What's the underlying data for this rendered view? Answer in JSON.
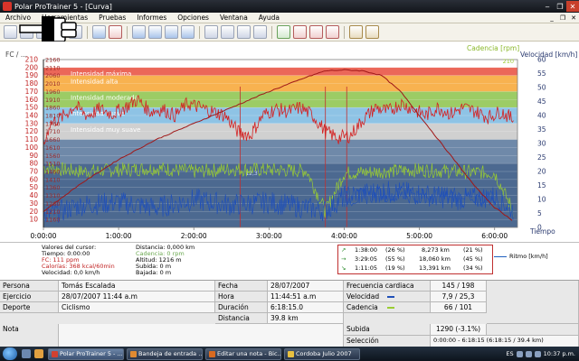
{
  "window": {
    "title": "Polar ProTrainer 5 - [Curva]"
  },
  "menu": {
    "items": [
      "Archivo",
      "Herramientas",
      "Pruebas",
      "Informes",
      "Opciones",
      "Ventana",
      "Ayuda"
    ],
    "mdi_buttons": [
      "_",
      "❐",
      "✕"
    ]
  },
  "chart": {
    "left_axis_title": "FC / ...",
    "cadence_title": "Cadencia [rpm]",
    "speed_title": "Velocidad [km/h]",
    "x_axis_title": "Tiempo",
    "marker_label": "12,3",
    "hr_ticks": [
      "210",
      "200",
      "190",
      "180",
      "170",
      "160",
      "150",
      "140",
      "130",
      "120",
      "110",
      "100",
      "90",
      "80",
      "70",
      "60",
      "50",
      "40",
      "30",
      "20",
      "10"
    ],
    "alt_ticks": [
      "2160",
      "2110",
      "2060",
      "2010",
      "1960",
      "1910",
      "1860",
      "1810",
      "1760",
      "1710",
      "1660",
      "1610",
      "1560",
      "1510",
      "1460",
      "1410",
      "1360",
      "1310",
      "1260",
      "1210",
      "1160"
    ],
    "speed_ticks": [
      "60",
      "55",
      "50",
      "45",
      "40",
      "35",
      "30",
      "25",
      "20",
      "15",
      "10",
      "5",
      "0"
    ],
    "cadence_top": "210",
    "time_ticks": [
      "0:00:00",
      "1:00:00",
      "2:00:00",
      "3:00:00",
      "4:00:00",
      "5:00:00",
      "6:00:00"
    ],
    "zones": [
      {
        "label": "Intensidad máxima",
        "color": "#e84c3c"
      },
      {
        "label": "Intensidad alta",
        "color": "#f7a531"
      },
      {
        "label": "Intensidad moderada",
        "color": "#8bc34a"
      },
      {
        "label": "Intensidad suave",
        "color": "#7ab8e0"
      },
      {
        "label": "Intensidad muy suave",
        "color": "#c8c8c8"
      }
    ],
    "colors": {
      "hr": "#d42020",
      "altitude": "#a01818",
      "speed": "#2050b8",
      "cadence": "#9acd32"
    }
  },
  "chart_data": {
    "type": "line",
    "x_unit": "time (h:mm:ss)",
    "xlim": [
      "0:00:00",
      "6:18:15"
    ],
    "ylim_hr": [
      0,
      210
    ],
    "ylim_speed": [
      0,
      60
    ],
    "series": [
      {
        "name": "FC",
        "axis": "hr",
        "x": [
          "0:00:00",
          "0:05:00",
          "0:15:00",
          "0:25:00",
          "0:35:00",
          "0:45:00",
          "0:55:00",
          "1:05:00",
          "1:15:00",
          "1:25:00",
          "1:35:00",
          "1:45:00",
          "1:55:00",
          "2:05:00",
          "2:15:00",
          "2:25:00",
          "2:35:00",
          "2:45:00",
          "2:55:00",
          "3:05:00",
          "3:15:00",
          "3:25:00",
          "3:35:00",
          "3:45:00",
          "3:55:00",
          "4:05:00",
          "4:15:00",
          "4:25:00",
          "4:35:00",
          "4:45:00",
          "4:55:00",
          "5:05:00",
          "5:15:00",
          "5:25:00",
          "5:35:00",
          "5:45:00",
          "5:55:00",
          "6:05:00",
          "6:15:00"
        ],
        "values": [
          100,
          130,
          138,
          152,
          140,
          148,
          142,
          150,
          160,
          145,
          148,
          140,
          155,
          150,
          145,
          140,
          120,
          115,
          140,
          148,
          145,
          150,
          140,
          120,
          112,
          115,
          135,
          150,
          145,
          155,
          148,
          140,
          150,
          142,
          150,
          145,
          138,
          145,
          135
        ]
      },
      {
        "name": "Altitud",
        "axis": "hr",
        "x": [
          "0:00:00",
          "0:30:00",
          "1:00:00",
          "1:30:00",
          "2:00:00",
          "2:30:00",
          "3:00:00",
          "3:30:00",
          "3:45:00",
          "4:00:00",
          "4:15:00",
          "4:30:00",
          "4:45:00",
          "5:00:00",
          "5:15:00",
          "5:30:00",
          "5:45:00",
          "6:00:00",
          "6:15:00"
        ],
        "values": [
          20,
          55,
          85,
          110,
          130,
          150,
          170,
          188,
          196,
          197,
          196,
          190,
          170,
          140,
          110,
          80,
          50,
          25,
          8
        ]
      },
      {
        "name": "Velocidad",
        "axis": "speed",
        "x": [
          "0:00:00",
          "0:30:00",
          "1:00:00",
          "1:30:00",
          "2:00:00",
          "2:30:00",
          "3:00:00",
          "3:30:00",
          "3:45:00",
          "4:00:00",
          "4:30:00",
          "5:00:00",
          "5:30:00",
          "6:00:00",
          "6:15:00"
        ],
        "values": [
          4,
          8,
          9,
          7,
          10,
          8,
          9,
          7,
          6,
          11,
          13,
          12,
          10,
          11,
          6
        ]
      },
      {
        "name": "Cadencia",
        "axis": "hr",
        "x": [
          "0:00:00",
          "0:30:00",
          "1:00:00",
          "1:30:00",
          "2:00:00",
          "2:30:00",
          "3:00:00",
          "3:30:00",
          "3:45:00",
          "4:00:00",
          "4:30:00",
          "5:00:00",
          "5:30:00",
          "6:00:00",
          "6:15:00"
        ],
        "values": [
          75,
          70,
          72,
          74,
          70,
          73,
          72,
          71,
          20,
          68,
          70,
          72,
          70,
          68,
          20
        ]
      },
      {
        "name": "Ritmo [km/h]",
        "axis": "speed",
        "x": [
          "4:00:00",
          "4:30:00",
          "5:00:00",
          "5:30:00",
          "6:00:00"
        ],
        "values": [
          10,
          12,
          11,
          12,
          10
        ]
      }
    ]
  },
  "cursor": {
    "title": "Valores del cursor:",
    "time": "Tiempo: 0:00:00",
    "hr": "FC: 111 ppm",
    "calories": "Calorías: 368 kcal/60min",
    "speed": "Velocidad: 0,0 km/h",
    "distance": "Distancia: 0,000 km",
    "cadence": "Cadencia: 0 rpm",
    "altitude": "Altitud: 1216 m",
    "ascent": "Subida: 0 m",
    "descent": "Bajada: 0 m"
  },
  "zones_summary": [
    {
      "arrow": "↗",
      "time": "1:38:00",
      "pct": "(26 %)",
      "km": "8,273 km",
      "kmpct": "(21 %)"
    },
    {
      "arrow": "→",
      "time": "3:29:05",
      "pct": "(55 %)",
      "km": "18,060 km",
      "kmpct": "(45 %)"
    },
    {
      "arrow": "↘",
      "time": "1:11:05",
      "pct": "(19 %)",
      "km": "13,391 km",
      "kmpct": "(34 %)"
    }
  ],
  "legend": {
    "ritmo": "Ritmo [km/h]"
  },
  "info": {
    "persona_label": "Persona",
    "persona_value": "Tomás Escalada",
    "ejercicio_label": "Ejercicio",
    "ejercicio_value": "28/07/2007 11:44 a.m",
    "deporte_label": "Deporte",
    "deporte_value": "Ciclismo",
    "fecha_label": "Fecha",
    "fecha_value": "28/07/2007",
    "hora_label": "Hora",
    "hora_value": "11:44:51 a.m",
    "duracion_label": "Duración",
    "duracion_value": "6:18:15.0",
    "distancia_label": "Distancia",
    "distancia_value": "39.8 km",
    "fc_label": "Frecuencia cardiaca",
    "fc_value": "145 / 198",
    "vel_label": "Velocidad",
    "vel_value": "7,9 / 25,3",
    "cad_label": "Cadencia",
    "cad_value": "66 / 101",
    "nota_label": "Nota",
    "subida_label": "Subida",
    "subida_value": "1290 (-3.1%)",
    "seleccion_label": "Selección",
    "seleccion_value": "0:00:00 - 6:18:15 (6:18:15 / 39.4 km)"
  },
  "taskbar": {
    "tasks": [
      "Polar ProTrainer 5 - ...",
      "Bandeja de entrada ...",
      "Editar una nota - Bic...",
      "Cordoba Julio 2007"
    ],
    "lang": "ES",
    "clock": "10:37 p.m."
  }
}
